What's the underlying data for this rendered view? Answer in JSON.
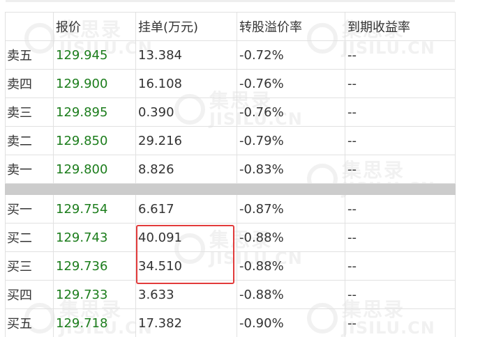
{
  "watermark": {
    "cn": "集思录",
    "en": "JISILU.CN"
  },
  "table": {
    "headers": [
      "",
      "报价",
      "挂单(万元)",
      "转股溢价率",
      "到期收益率"
    ],
    "asks": [
      {
        "label": "卖五",
        "price": "129.945",
        "volume": "13.384",
        "premium": "-0.72%",
        "ytm": "--"
      },
      {
        "label": "卖四",
        "price": "129.900",
        "volume": "16.108",
        "premium": "-0.76%",
        "ytm": "--"
      },
      {
        "label": "卖三",
        "price": "129.895",
        "volume": "0.390",
        "premium": "-0.76%",
        "ytm": "--"
      },
      {
        "label": "卖二",
        "price": "129.850",
        "volume": "29.216",
        "premium": "-0.79%",
        "ytm": "--"
      },
      {
        "label": "卖一",
        "price": "129.800",
        "volume": "8.826",
        "premium": "-0.83%",
        "ytm": "--"
      }
    ],
    "bids": [
      {
        "label": "买一",
        "price": "129.754",
        "volume": "6.617",
        "premium": "-0.87%",
        "ytm": "--"
      },
      {
        "label": "买二",
        "price": "129.743",
        "volume": "40.091",
        "premium": "-0.88%",
        "ytm": "--"
      },
      {
        "label": "买三",
        "price": "129.736",
        "volume": "34.510",
        "premium": "-0.88%",
        "ytm": "--"
      },
      {
        "label": "买四",
        "price": "129.733",
        "volume": "3.633",
        "premium": "-0.88%",
        "ytm": "--"
      },
      {
        "label": "买五",
        "price": "129.718",
        "volume": "17.382",
        "premium": "-0.90%",
        "ytm": "--"
      }
    ]
  },
  "colors": {
    "price": "#1c7d1c",
    "text": "#333333",
    "border": "#e1e1e1",
    "separator": "#cccccc",
    "highlight": "#e23b3b"
  }
}
